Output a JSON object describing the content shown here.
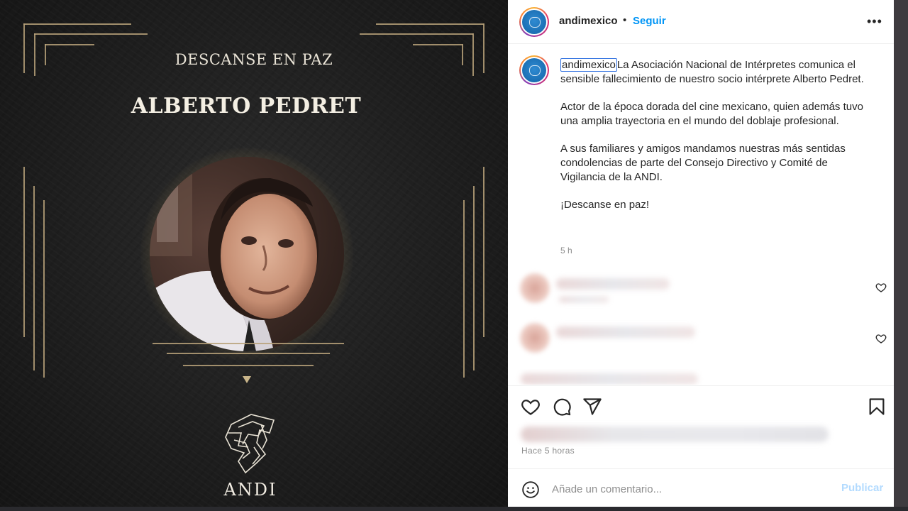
{
  "post_image": {
    "kicker": "DESCANSE EN PAZ",
    "name": "ALBERTO PEDRET",
    "org_wordmark": "ANDI"
  },
  "header": {
    "username": "andimexico",
    "separator": "•",
    "follow_label": "Seguir",
    "more_icon": "more-horizontal-icon"
  },
  "caption": {
    "username": "andimexico",
    "paragraph_1": "La Asociación Nacional de Intérpretes comunica el sensible fallecimiento de nuestro socio intérprete Alberto Pedret.",
    "paragraph_2": "Actor de la época dorada del cine mexicano, quien además tuvo una amplia trayectoria en el mundo del doblaje profesional.",
    "paragraph_3": "A sus familiares y amigos mandamos nuestras más sentidas condolencias de parte del Consejo Directivo y Comité de Vigilancia de la ANDI.",
    "paragraph_4": "¡Descanse en paz!",
    "age": "5 h"
  },
  "actions": {
    "icons": [
      "heart-icon",
      "comment-icon",
      "share-icon",
      "bookmark-icon"
    ]
  },
  "post_time": "Hace 5 horas",
  "add_comment": {
    "placeholder": "Añade un comentario...",
    "publish_label": "Publicar"
  },
  "colors": {
    "link_blue": "#0095f6",
    "publish_disabled": "#b3dbff",
    "gold_accent": "#b8a27a"
  }
}
